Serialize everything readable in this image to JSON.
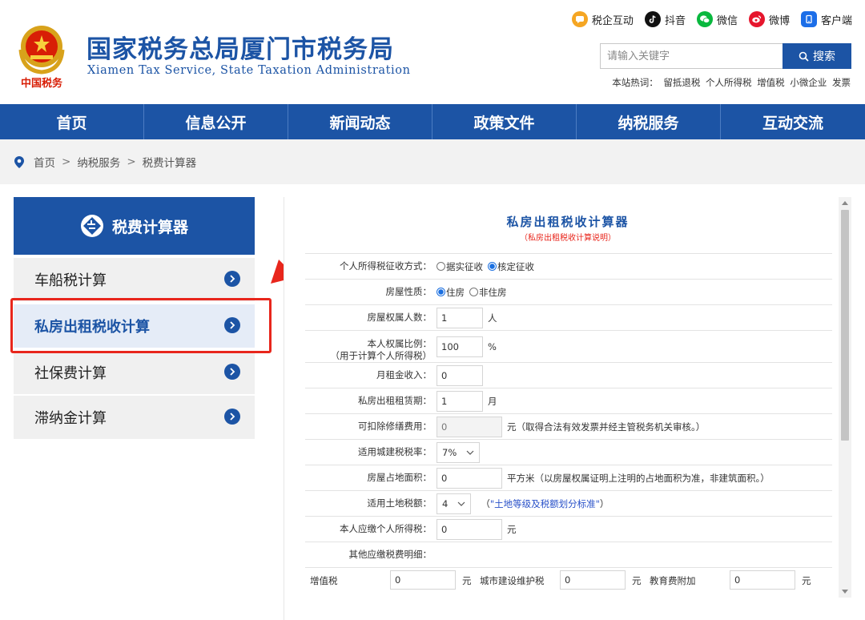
{
  "header": {
    "title": "国家税务总局厦门市税务局",
    "subtitle": "Xiamen Tax Service, State Taxation Administration",
    "logo_text": "中国税务",
    "top_links": [
      {
        "label": "税企互动",
        "icon": "chat-icon",
        "color": "#f5a623"
      },
      {
        "label": "抖音",
        "icon": "douyin-icon",
        "color": "#111111"
      },
      {
        "label": "微信",
        "icon": "wechat-icon",
        "color": "#09b83e"
      },
      {
        "label": "微博",
        "icon": "weibo-icon",
        "color": "#e6162d"
      },
      {
        "label": "客户端",
        "icon": "app-client-icon",
        "color": "#1c6ee8"
      }
    ],
    "search": {
      "placeholder": "请输入关键字",
      "button": "搜索"
    },
    "hot": {
      "label": "本站热词：",
      "words": [
        "留抵退税",
        "个人所得税",
        "增值税",
        "小微企业",
        "发票"
      ]
    }
  },
  "nav": [
    "首页",
    "信息公开",
    "新闻动态",
    "政策文件",
    "纳税服务",
    "互动交流"
  ],
  "breadcrumb": [
    "首页",
    "纳税服务",
    "税费计算器"
  ],
  "breadcrumb_sep": ">",
  "sidebar": {
    "title": "税费计算器",
    "items": [
      {
        "label": "车船税计算",
        "active": false
      },
      {
        "label": "私房出租税收计算",
        "active": true
      },
      {
        "label": "社保费计算",
        "active": false
      },
      {
        "label": "滞纳金计算",
        "active": false
      }
    ]
  },
  "calc": {
    "title": "私房出租税收计算器",
    "note": "（私房出租税收计算说明）",
    "rows": {
      "method": {
        "label": "个人所得税征收方式：",
        "opt1": "据实征收",
        "opt2": "核定征收"
      },
      "nature": {
        "label": "房屋性质：",
        "opt1": "住房",
        "opt2": "非住房"
      },
      "owners": {
        "label": "房屋权属人数：",
        "value": "1",
        "unit": "人"
      },
      "ratio": {
        "label1": "本人权属比例：",
        "label2": "（用于计算个人所得税）",
        "value": "100",
        "unit": "%"
      },
      "rent": {
        "label": "月租金收入：",
        "value": "0"
      },
      "term": {
        "label": "私房出租租赁期：",
        "value": "1",
        "unit": "月"
      },
      "repair": {
        "label": "可扣除修缮费用：",
        "value": "0",
        "unit": "元（取得合法有效发票并经主管税务机关审核。）"
      },
      "city_rate": {
        "label": "适用城建税税率：",
        "value": "7%"
      },
      "area": {
        "label": "房屋占地面积：",
        "value": "0",
        "unit": "平方米（以房屋权属证明上注明的占地面积为准，非建筑面积。）"
      },
      "land_tax": {
        "label": "适用土地税额：",
        "value": "4",
        "note_open": "（",
        "note_link": "\"土地等级及税额划分标准\"",
        "note_close": "）"
      },
      "iit": {
        "label": "本人应缴个人所得税：",
        "value": "0",
        "unit": "元"
      },
      "other": {
        "label": "其他应缴税费明细："
      },
      "vat": {
        "label": "增值税",
        "value": "0",
        "unit": "元"
      },
      "city": {
        "label": "城市建设维护税",
        "value": "0",
        "unit": "元"
      },
      "edu": {
        "label": "教育费附加",
        "value": "0",
        "unit": "元"
      }
    }
  },
  "colors": {
    "brand": "#1c54a5",
    "highlight": "#e8261c",
    "link": "#2a52c9"
  }
}
